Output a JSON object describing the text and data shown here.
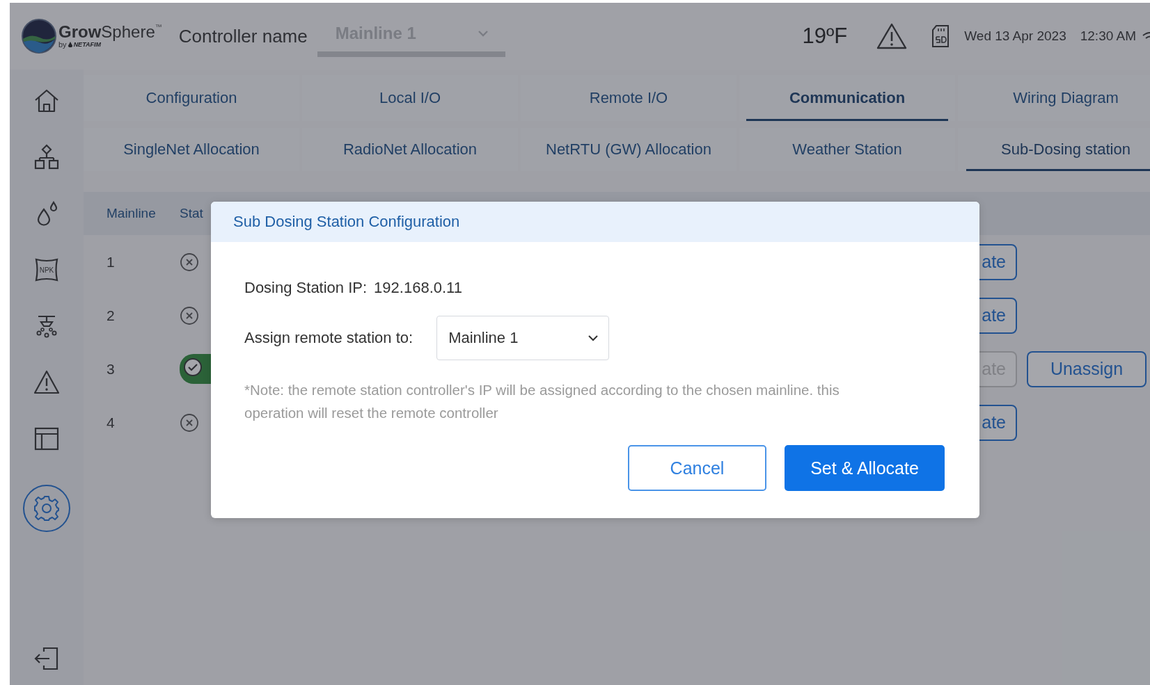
{
  "header": {
    "logo": {
      "brand": "**Grow**Sphere",
      "trademark": "™",
      "byline": "by",
      "maker": "NETAFIM"
    },
    "controller_label": "Controller name",
    "controller_select": {
      "value": "Mainline 1",
      "disabled": true
    },
    "temperature": "19ºF",
    "date": "Wed 13 Apr 2023",
    "time": "12:30 AM"
  },
  "sidebar": {
    "items": [
      {
        "selected": false
      },
      {
        "selected": false
      },
      {
        "selected": false
      },
      {
        "selected": false,
        "text": "NPK"
      },
      {
        "selected": false
      },
      {
        "selected": false
      },
      {
        "selected": false
      },
      {
        "selected": true
      }
    ]
  },
  "main_tabs": [
    {
      "label": "Configuration",
      "selected": false
    },
    {
      "label": "Local I/O",
      "selected": false
    },
    {
      "label": "Remote I/O",
      "selected": false
    },
    {
      "label": "Communication",
      "selected": true
    },
    {
      "label": "Wiring Diagram",
      "selected": false
    }
  ],
  "sub_tabs": [
    {
      "label": "SingleNet Allocation",
      "selected": false
    },
    {
      "label": "RadioNet Allocation",
      "selected": false
    },
    {
      "label": "NetRTU (GW) Allocation",
      "selected": false
    },
    {
      "label": "Weather Station",
      "selected": false
    },
    {
      "label": "Sub-Dosing station",
      "selected": true
    }
  ],
  "table": {
    "columns": [
      "Mainline",
      "Stat"
    ],
    "rows": [
      {
        "mainline": "1",
        "connected": false,
        "actions": [
          {
            "label": "ate",
            "disabled": false
          }
        ]
      },
      {
        "mainline": "2",
        "connected": false,
        "actions": [
          {
            "label": "ate",
            "disabled": false
          }
        ]
      },
      {
        "mainline": "3",
        "connected": true,
        "actions": [
          {
            "label": "ate",
            "disabled": true
          },
          {
            "label": "Unassign",
            "disabled": false
          }
        ]
      },
      {
        "mainline": "4",
        "connected": false,
        "actions": [
          {
            "label": "ate",
            "disabled": false
          }
        ]
      }
    ]
  },
  "dialog": {
    "title": "Sub Dosing Station Configuration",
    "ip_label": "Dosing Station IP:",
    "ip_value": "192.168.0.11",
    "assign_label": "Assign remote station to:",
    "assign_select": {
      "value": "Mainline 1"
    },
    "note": "*Note: the remote station controller's IP will be assigned according to the chosen mainline. this operation will reset the remote controller",
    "buttons": [
      {
        "label": "Cancel",
        "kind": "secondary"
      },
      {
        "label": "Set & Allocate",
        "kind": "primary"
      }
    ]
  }
}
